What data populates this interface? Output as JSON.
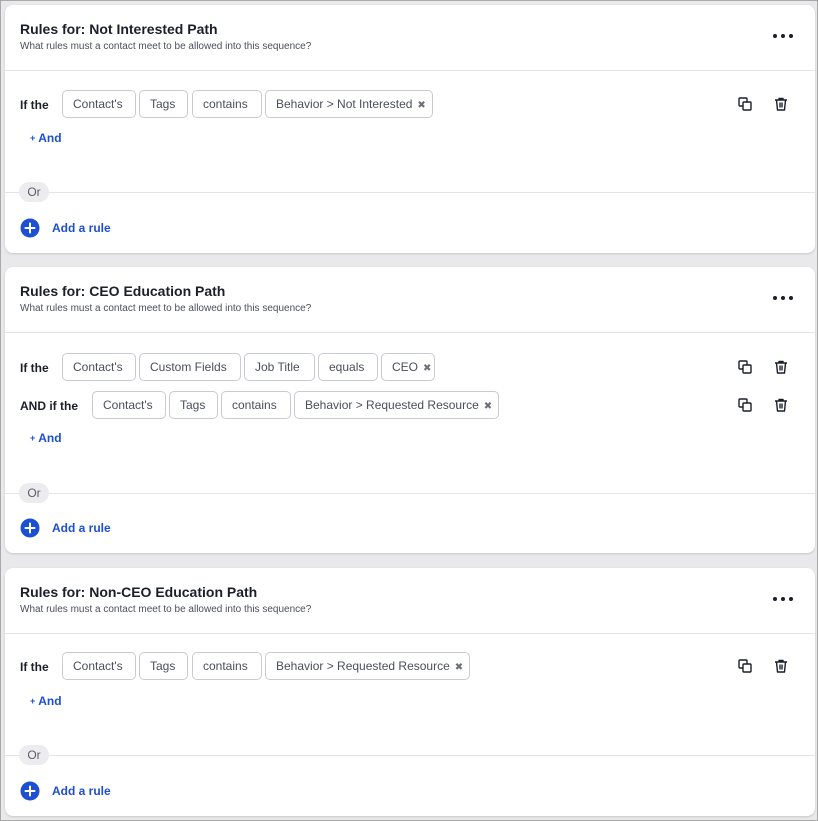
{
  "colors": {
    "accent": "#1c4fd1",
    "text": "#1b1f2a",
    "muted": "#4a4f5a",
    "chip_border": "#c9cbd1"
  },
  "icons": {
    "more": "ellipsis-icon",
    "copy": "copy-icon",
    "trash": "trash-icon",
    "add": "plus-circle-icon",
    "remove_chip": "close-icon"
  },
  "cards": [
    {
      "title": "Rules for: Not Interested Path",
      "subtitle": "What rules must a contact meet to be allowed into this sequence?",
      "rows": [
        {
          "lead": "If the",
          "chips": [
            "Contact's",
            "Tags",
            "contains"
          ],
          "value": "Behavior > Not Interested"
        }
      ],
      "and_label": "And",
      "or_label": "Or",
      "add_rule_label": "Add a rule"
    },
    {
      "title": "Rules for: CEO Education Path",
      "subtitle": "What rules must a contact meet to be allowed into this sequence?",
      "rows": [
        {
          "lead": "If the",
          "chips": [
            "Contact's",
            "Custom Fields",
            "Job Title",
            "equals"
          ],
          "value": "CEO"
        },
        {
          "lead": "AND if the",
          "chips": [
            "Contact's",
            "Tags",
            "contains"
          ],
          "value": "Behavior > Requested Resource"
        }
      ],
      "and_label": "And",
      "or_label": "Or",
      "add_rule_label": "Add a rule"
    },
    {
      "title": "Rules for: Non-CEO Education Path",
      "subtitle": "What rules must a contact meet to be allowed into this sequence?",
      "rows": [
        {
          "lead": "If the",
          "chips": [
            "Contact's",
            "Tags",
            "contains"
          ],
          "value": "Behavior > Requested Resource"
        }
      ],
      "and_label": "And",
      "or_label": "Or",
      "add_rule_label": "Add a rule"
    }
  ]
}
